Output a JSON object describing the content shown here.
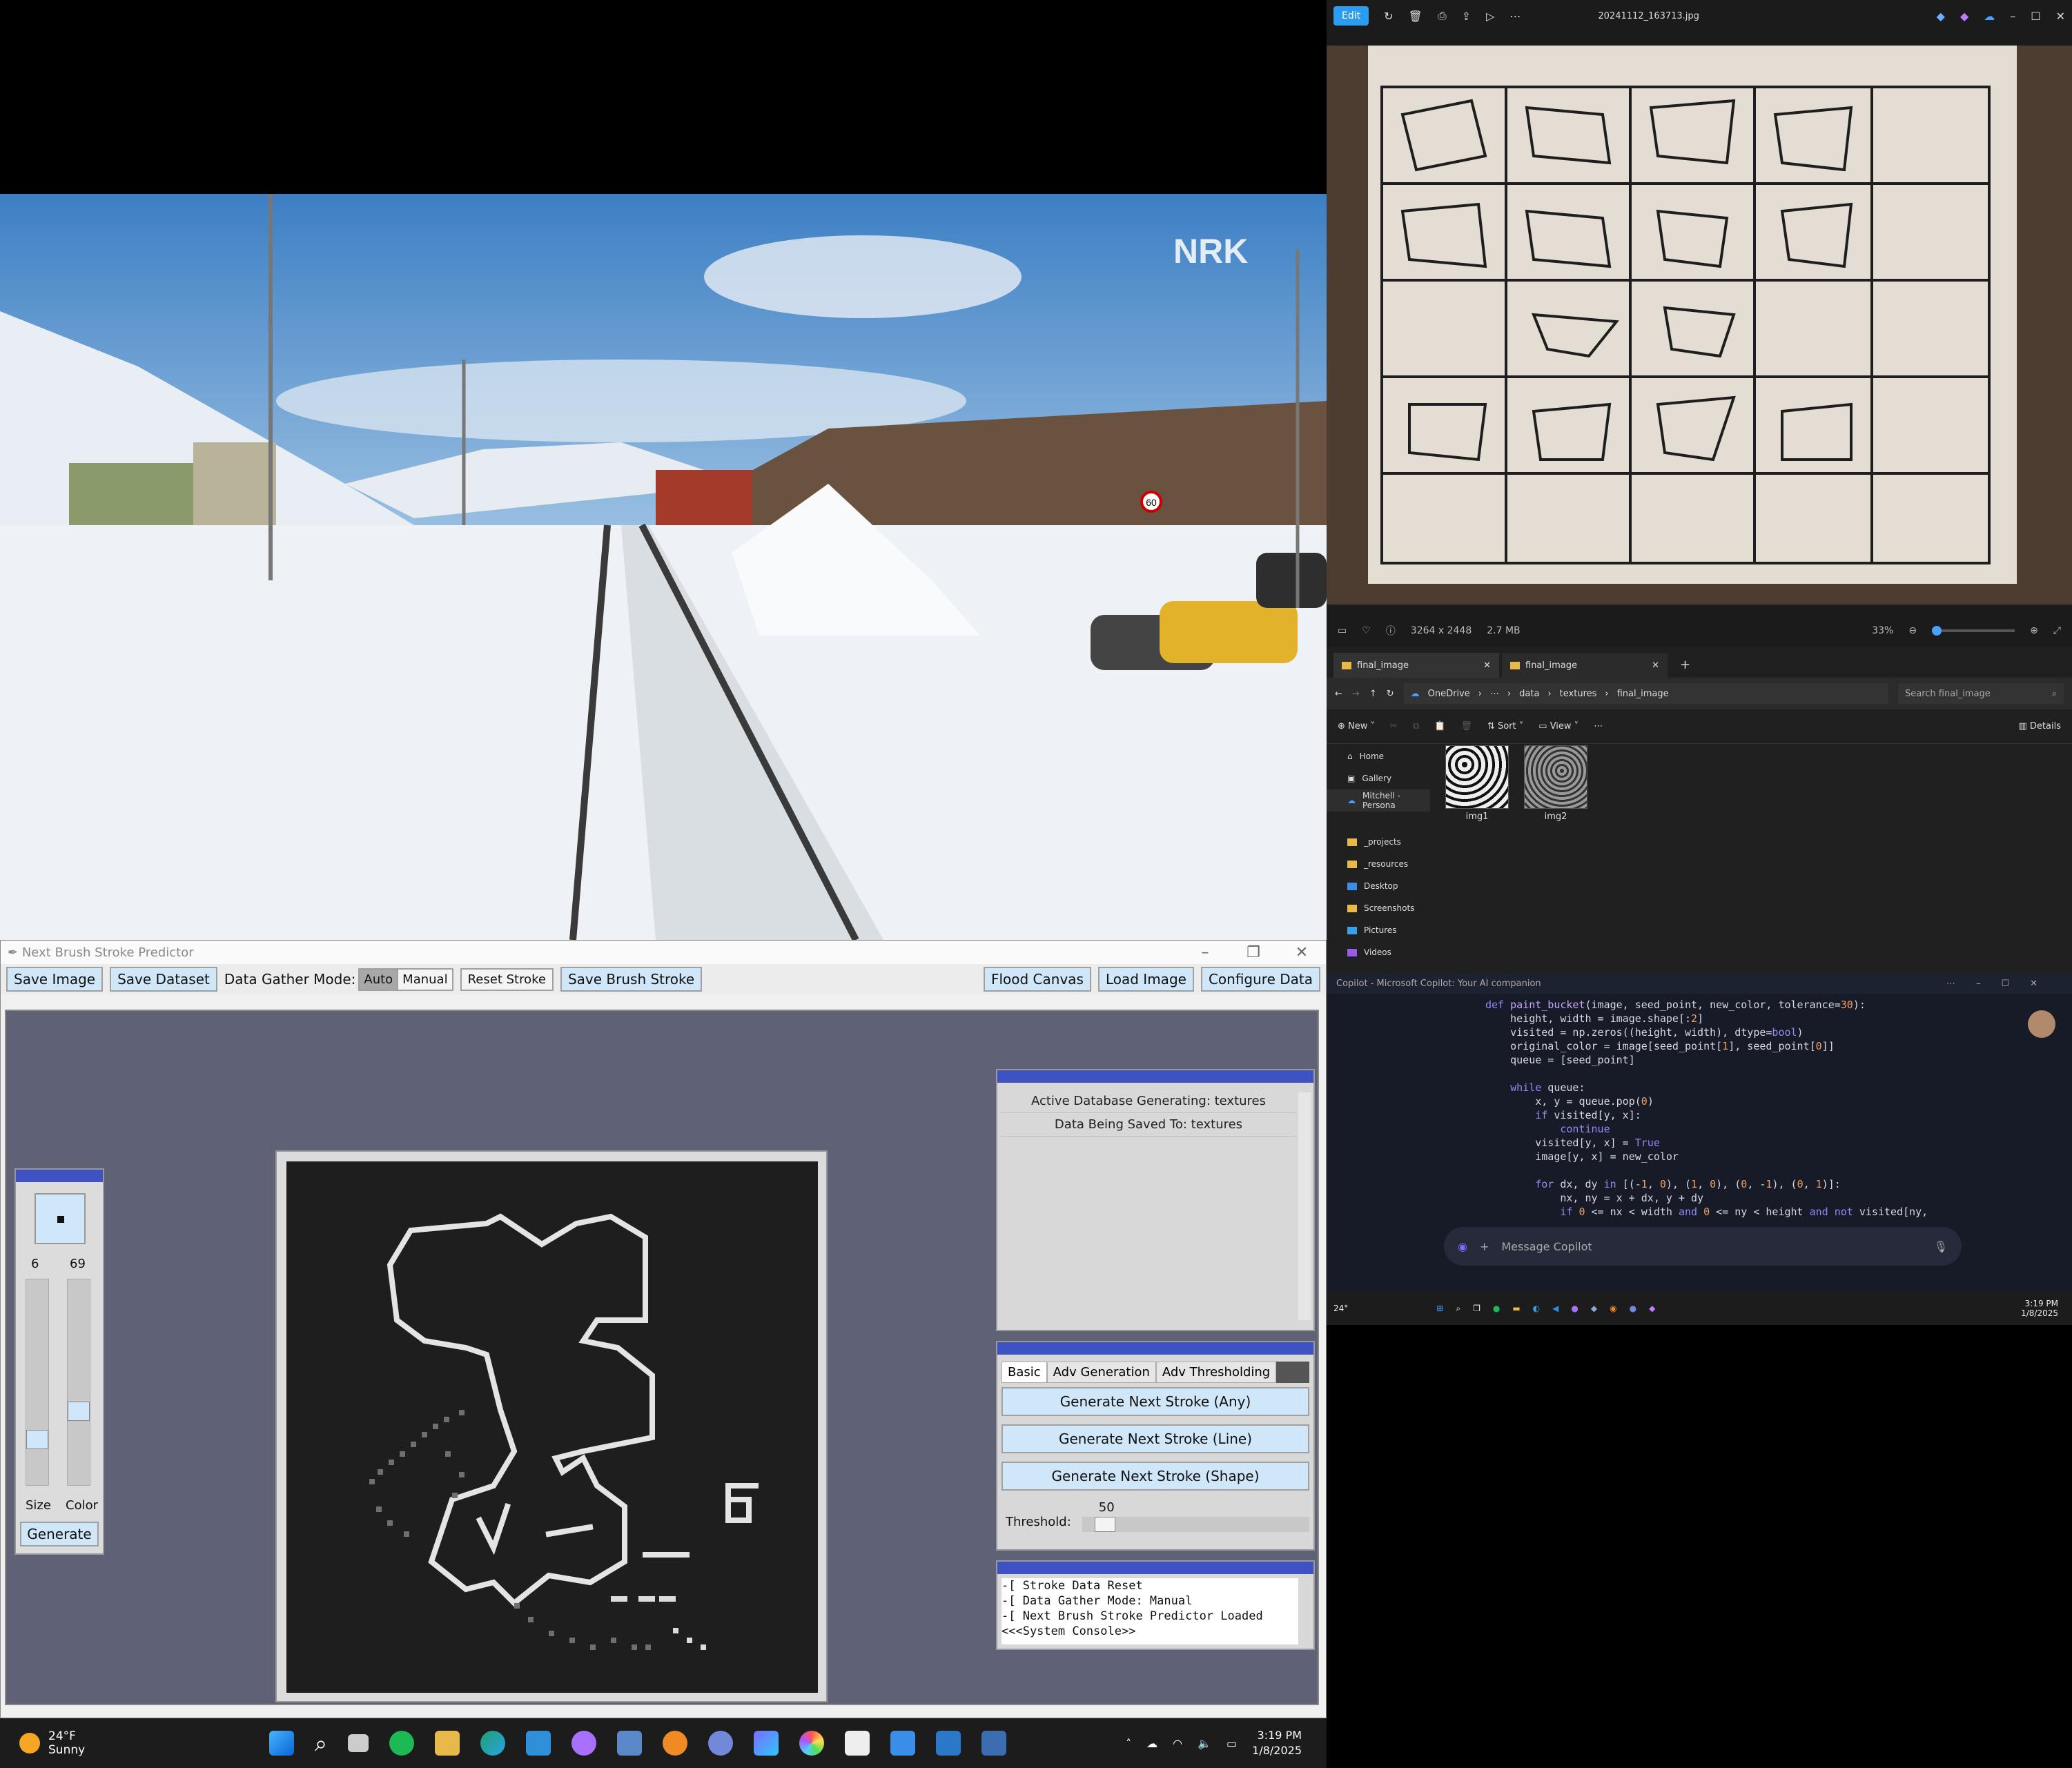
{
  "video": {
    "watermark": "NRK",
    "sign": "60"
  },
  "app": {
    "title": "Next Brush Stroke Predictor",
    "toolbar": {
      "save_image": "Save Image",
      "save_dataset": "Save Dataset",
      "mode_label": "Data Gather Mode:",
      "mode_auto": "Auto",
      "mode_manual": "Manual",
      "reset_stroke": "Reset Stroke",
      "save_brush": "Save Brush Stroke",
      "flood_canvas": "Flood Canvas",
      "load_image": "Load Image",
      "configure_data": "Configure Data"
    },
    "brush": {
      "size_value": "6",
      "color_value": "69",
      "size_label": "Size",
      "color_label": "Color",
      "size_level": 0.2,
      "color_level": 0.35,
      "generate": "Generate"
    },
    "info": {
      "active_db": "Active Database Generating: textures",
      "saving_to": "Data Being Saved To:  textures"
    },
    "gen": {
      "tabs": [
        "Basic",
        "Adv Generation",
        "Adv Thresholding"
      ],
      "any": "Generate Next Stroke (Any)",
      "line": "Generate Next Stroke (Line)",
      "shape": "Generate Next Stroke (Shape)",
      "threshold_label": "Threshold:",
      "threshold_value": "50"
    },
    "console": [
      "-[ Stroke Data Reset",
      "-[ Data Gather Mode: Manual",
      "-[ Next Brush Stroke Predictor Loaded",
      "<<<System Console>>"
    ]
  },
  "photos": {
    "edit": "Edit",
    "filename": "20241112_163713.jpg",
    "dims": "3264 x 2448",
    "size": "2.7 MB",
    "zoom": "33%"
  },
  "explorer": {
    "tabs": [
      "final_image",
      "final_image"
    ],
    "crumbs": [
      "OneDrive",
      "data",
      "textures",
      "final_image"
    ],
    "search": "Search final_image",
    "cmd": {
      "new": "New",
      "sort": "Sort",
      "view": "View",
      "details": "Details"
    },
    "nav": [
      "Home",
      "Gallery",
      "Mitchell - Persona",
      "_projects",
      "_resources",
      "Desktop",
      "Screenshots",
      "Pictures",
      "Videos"
    ],
    "files": [
      "img1",
      "img2"
    ]
  },
  "copilot": {
    "title": "Copilot - Microsoft Copilot: Your AI companion",
    "placeholder": "Message Copilot",
    "time": "3:19 PM",
    "date": "1/8/2025",
    "weather_small": "24°"
  },
  "taskbar": {
    "temp": "24°F",
    "condition": "Sunny",
    "time": "3:19 PM",
    "date": "1/8/2025"
  }
}
